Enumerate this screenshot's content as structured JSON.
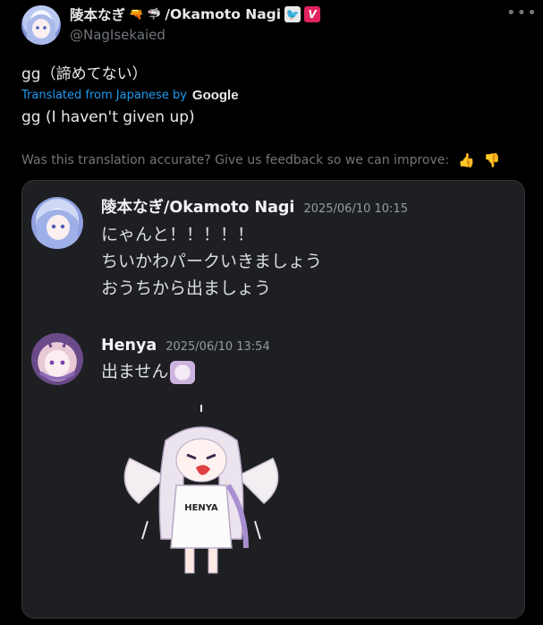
{
  "author": {
    "display_name": "陵本なぎ",
    "name_suffix": "/Okamoto Nagi",
    "handle": "@NagIsekaied",
    "gun_emoji": "🔫",
    "shark_emoji": "🦈",
    "bird_badge": "🐦",
    "v_badge": "V",
    "more_label": "•••"
  },
  "tweet": {
    "text": "gg（諦めてない）",
    "translated_label": "Translated from Japanese by",
    "translator": "Google",
    "translation": "gg (I haven't given up)",
    "feedback_prompt": "Was this translation accurate? Give us feedback so we can improve:",
    "thumbs_up": "👍",
    "thumbs_down": "👎"
  },
  "media": {
    "messages": [
      {
        "author": "陵本なぎ/Okamoto Nagi",
        "time": "2025/06/10 10:15",
        "lines": [
          "にゃんと！！！！！",
          "ちいかわパークいきましょう",
          "おうちから出ましょう"
        ]
      },
      {
        "author": "Henya",
        "time": "2025/06/10 13:54",
        "lines": [
          "出ません"
        ]
      }
    ],
    "sticker_text": "HENYA"
  },
  "colors": {
    "background": "#000000",
    "link_blue": "#1d9bf0",
    "muted": "#71767b",
    "card_bg": "#1e1f22",
    "v_badge": "#e0245e"
  }
}
